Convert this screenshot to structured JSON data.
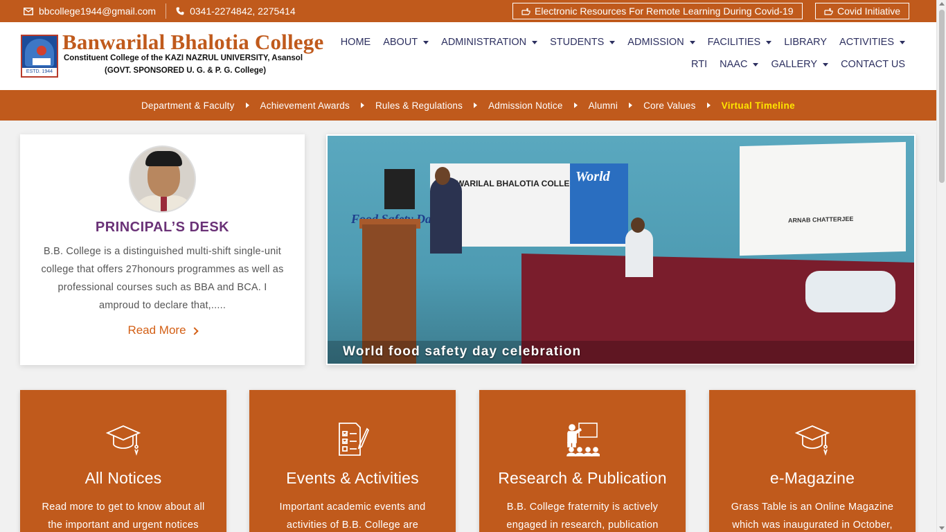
{
  "topbar": {
    "email": "bbcollege1944@gmail.com",
    "email_icon": "envelope-icon",
    "phone": "0341-2274842, 2275414",
    "phone_icon": "phone-icon",
    "btn_resources": "Electronic Resources For Remote Learning During Covid-19",
    "btn_covid": "Covid Initiative",
    "btn_icon": "hand-pointer-icon"
  },
  "brand": {
    "name": "Banwarilal Bhalotia College",
    "sub1": "Constituent College of the KAZI NAZRUL UNIVERSITY, Asansol",
    "sub2": "(GOVT. SPONSORED U. G. & P. G. College)",
    "estd": "ESTD. 1944"
  },
  "menu": {
    "row1": [
      {
        "label": "HOME",
        "dropdown": false
      },
      {
        "label": "ABOUT",
        "dropdown": true
      },
      {
        "label": "ADMINISTRATION",
        "dropdown": true
      },
      {
        "label": "STUDENTS",
        "dropdown": true
      },
      {
        "label": "ADMISSION",
        "dropdown": true
      },
      {
        "label": "FACILITIES",
        "dropdown": true
      },
      {
        "label": "LIBRARY",
        "dropdown": false
      },
      {
        "label": "ACTIVITIES",
        "dropdown": true
      }
    ],
    "row2": [
      {
        "label": "RTI",
        "dropdown": false
      },
      {
        "label": "NAAC",
        "dropdown": true
      },
      {
        "label": "GALLERY",
        "dropdown": true
      },
      {
        "label": "CONTACT US",
        "dropdown": false
      }
    ]
  },
  "subnav": {
    "items": [
      "Department & Faculty",
      "Achievement Awards",
      "Rules & Regulations",
      "Admission Notice",
      "Alumni",
      "Core Values",
      "Virtual Timeline"
    ],
    "highlight_color": "#ffe600"
  },
  "principal": {
    "title": "PRINCIPAL’S DESK",
    "text": "B.B. College is a distinguished multi-shift single-unit college that offers 27honours programmes as well as professional courses such as BBA and BCA. I amproud to declare that,.....",
    "read_more": "Read More"
  },
  "slider": {
    "caption": "World food safety day celebration",
    "banner_line": "BANWARILAL BHALOTIA COLLEGE, ASANSOL",
    "banner_title": "Food Safety Day",
    "poster_title": "World",
    "screen_name": "ARNAB CHATTERJEE"
  },
  "cards": [
    {
      "title": "All Notices",
      "text": "Read more to get to know about all the important and urgent notices",
      "icon": "graduation-cap-icon"
    },
    {
      "title": "Events & Activities",
      "text": "Important academic events and activities of B.B. College are",
      "icon": "checklist-icon"
    },
    {
      "title": "Research & Publication",
      "text": "B.B. College fraternity is actively engaged in research, publication",
      "icon": "presentation-icon"
    },
    {
      "title": "e-Magazine",
      "text": "Grass Table is an Online Magazine which was inaugurated in October,",
      "icon": "graduation-cap-icon"
    }
  ],
  "colors": {
    "primary": "#c05a1c",
    "nav_text": "#2d3060",
    "principal_title": "#6a3277",
    "read_more": "#d35f15"
  }
}
